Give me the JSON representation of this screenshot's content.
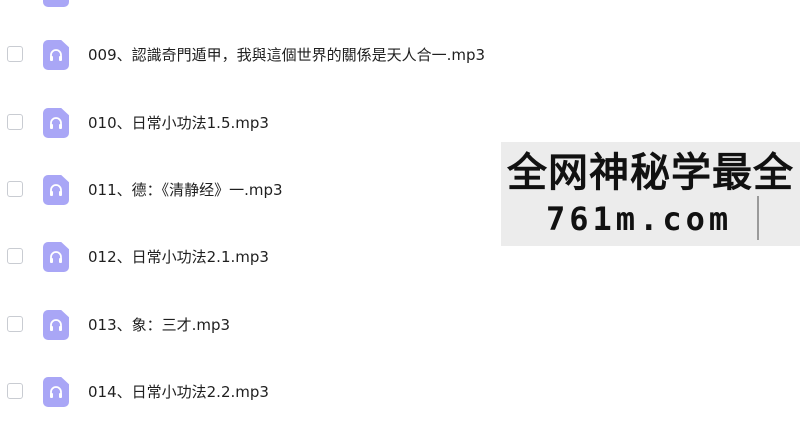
{
  "files": [
    {
      "name": "009、認識奇門遁甲，我與這個世界的關係是天人合一.mp3",
      "icon": "audio-file-icon"
    },
    {
      "name": "010、日常小功法1.5.mp3",
      "icon": "audio-file-icon"
    },
    {
      "name": "011、德：《清静经》一.mp3",
      "icon": "audio-file-icon"
    },
    {
      "name": "012、日常小功法2.1.mp3",
      "icon": "audio-file-icon"
    },
    {
      "name": "013、象：三才.mp3",
      "icon": "audio-file-icon"
    },
    {
      "name": "014、日常小功法2.2.mp3",
      "icon": "audio-file-icon"
    }
  ],
  "watermark": {
    "line1": "全网神秘学最全",
    "line2": "761m.com"
  },
  "colors": {
    "icon_fill": "#a9a6f6",
    "checkbox_border": "#c9ccd2"
  }
}
